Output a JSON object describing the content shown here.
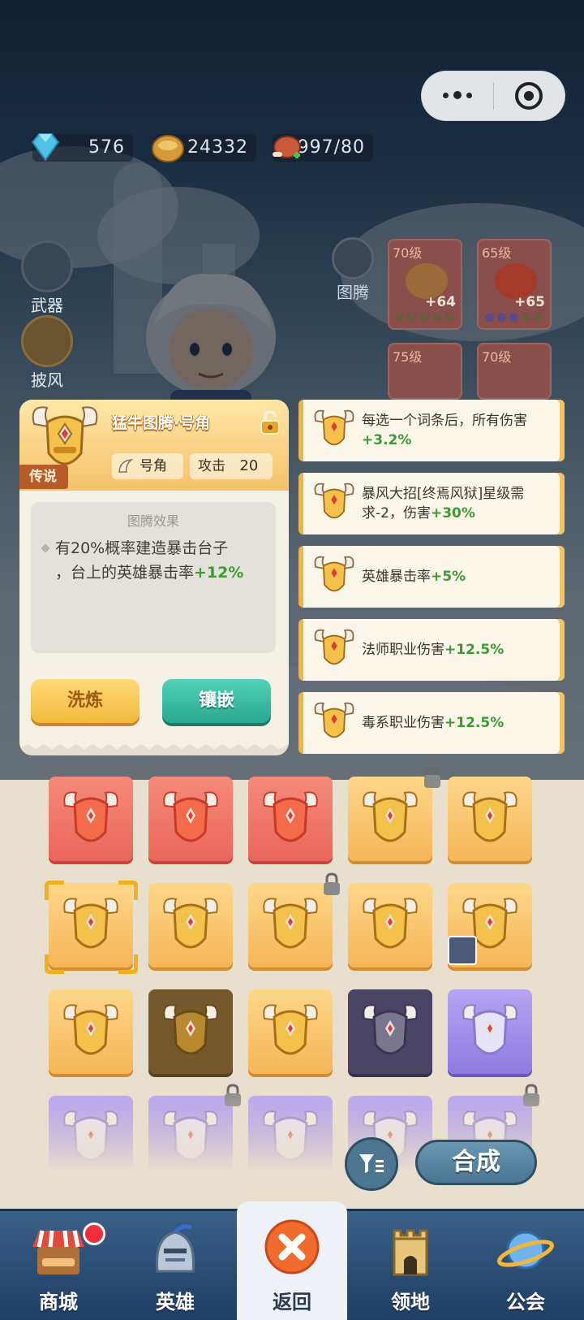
{
  "top_capsule": {
    "more_icon": "more-dots-icon",
    "close_icon": "target-icon"
  },
  "resources": {
    "diamonds": "576",
    "coins": "24332",
    "stamina": "1997/80"
  },
  "side_menu": {
    "weapon_label": "武器",
    "cloak_label": "披风",
    "totem_label": "图腾"
  },
  "equipped_slots": [
    {
      "level": "70级",
      "bonus": "+64"
    },
    {
      "level": "65级",
      "bonus": "+65"
    },
    {
      "level": "75级"
    },
    {
      "level": "70级"
    }
  ],
  "detail_card": {
    "title": "猛牛图腾·号角",
    "rarity": "传说",
    "slot_type": "号角",
    "stat_label": "攻击",
    "stat_value": "20",
    "effect_header": "图腾效果",
    "effect_line1": "有20%概率建造暴击台子",
    "effect_line2_prefix": "，台上的英雄暴击率",
    "effect_line2_value": "+12%",
    "wash_button": "洗炼",
    "inlay_button": "镶嵌"
  },
  "affix_options": [
    {
      "text": "每选一个词条后，所有伤害",
      "value": "+3.2%"
    },
    {
      "text": "暴风大招[终焉风狱]星级需求-2，伤害",
      "value": "+30%"
    },
    {
      "text": "英雄暴击率",
      "value": "+5%"
    },
    {
      "text": "法师职业伤害",
      "value": "+12.5%"
    },
    {
      "text": "毒系职业伤害",
      "value": "+12.5%"
    }
  ],
  "inventory_grid": {
    "rows": [
      [
        "red",
        "red",
        "red",
        "gold",
        "gold"
      ],
      [
        "gold",
        "gold",
        "gold",
        "gold",
        "gold"
      ],
      [
        "gold",
        "brown",
        "gold",
        "dark",
        "purple"
      ],
      [
        "purple",
        "purple",
        "purple",
        "purple",
        "purple"
      ]
    ]
  },
  "actions": {
    "filter_icon": "filter-icon",
    "synthesize_button": "合成"
  },
  "tabs": [
    {
      "label": "商城"
    },
    {
      "label": "英雄"
    },
    {
      "label": "返回"
    },
    {
      "label": "领地"
    },
    {
      "label": "公会"
    }
  ],
  "colors": {
    "accent_green": "#3f9a35",
    "gold": "#f5b657",
    "legend_tag": "#b75c28",
    "tabbar": "#2c4d74"
  }
}
